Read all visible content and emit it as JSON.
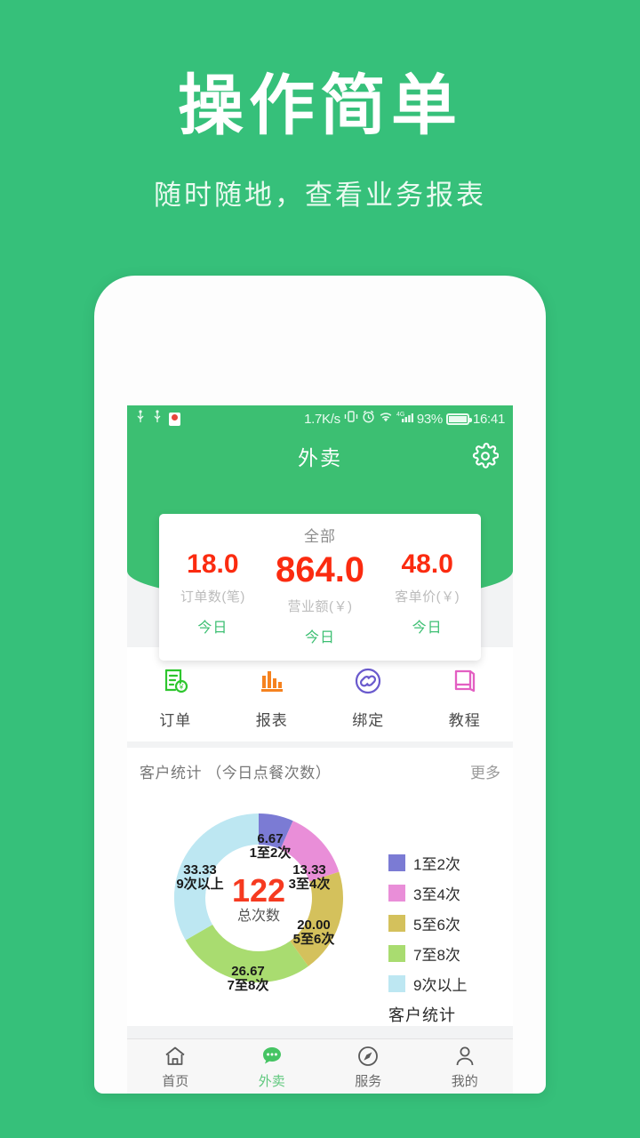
{
  "promo": {
    "title": "操作简单",
    "subtitle": "随时随地，查看业务报表"
  },
  "colors": {
    "brand_green": "#36c07a",
    "app_green": "#3cbf72",
    "accent_red": "#fb2b10",
    "tab_active": "#5fc87d"
  },
  "statusbar": {
    "usb_icon": "usb-icon",
    "usb_icon_2": "usb-icon",
    "location_icon": "location-pin-icon",
    "network_speed": "1.7K/s",
    "vibrate_icon": "vibrate-icon",
    "alarm_icon": "alarm-icon",
    "wifi_icon": "wifi-icon",
    "signal_icon": "signal-bars-icon",
    "battery_percent": "93%",
    "battery_icon": "battery-charging-icon",
    "clock": "16:41"
  },
  "appbar": {
    "title": "外卖",
    "settings_icon": "gear-icon"
  },
  "stats_card": {
    "header": "全部",
    "metrics": [
      {
        "value": "18.0",
        "label": "订单数(笔)",
        "period": "今日",
        "size": "small"
      },
      {
        "value": "864.0",
        "label": "营业额(￥)",
        "period": "今日",
        "size": "big"
      },
      {
        "value": "48.0",
        "label": "客单价(￥)",
        "period": "今日",
        "size": "small"
      }
    ]
  },
  "quick_actions": [
    {
      "label": "订单",
      "icon": "order-clipboard-icon",
      "color": "#2ec62e"
    },
    {
      "label": "报表",
      "icon": "bar-chart-icon",
      "color": "#f5821f"
    },
    {
      "label": "绑定",
      "icon": "link-chain-icon",
      "color": "#6a5acd"
    },
    {
      "label": "教程",
      "icon": "book-icon",
      "color": "#e35fc2"
    }
  ],
  "section": {
    "title": "客户统计 （今日点餐次数）",
    "more": "更多"
  },
  "chart_data": {
    "type": "pie",
    "title": "客户统计",
    "subtitle": "今日点餐次数",
    "center_value": "122",
    "center_label": "总次数",
    "total": 122,
    "legend_position": "right",
    "categories": [
      "1至2次",
      "3至4次",
      "5至6次",
      "7至8次",
      "9次以上"
    ],
    "values": [
      6.67,
      13.33,
      20.0,
      26.67,
      33.33
    ],
    "value_labels": [
      "6.67",
      "13.33",
      "20.00",
      "26.67",
      "33.33"
    ],
    "colors": [
      "#7b7bd4",
      "#e98ed8",
      "#d4c15c",
      "#a9dc70",
      "#bde7f2"
    ],
    "unit": "%"
  },
  "tabbar": [
    {
      "label": "首页",
      "icon": "home-icon",
      "active": false
    },
    {
      "label": "外卖",
      "icon": "chat-bubble-icon",
      "active": true
    },
    {
      "label": "服务",
      "icon": "compass-icon",
      "active": false
    },
    {
      "label": "我的",
      "icon": "person-icon",
      "active": false
    }
  ]
}
